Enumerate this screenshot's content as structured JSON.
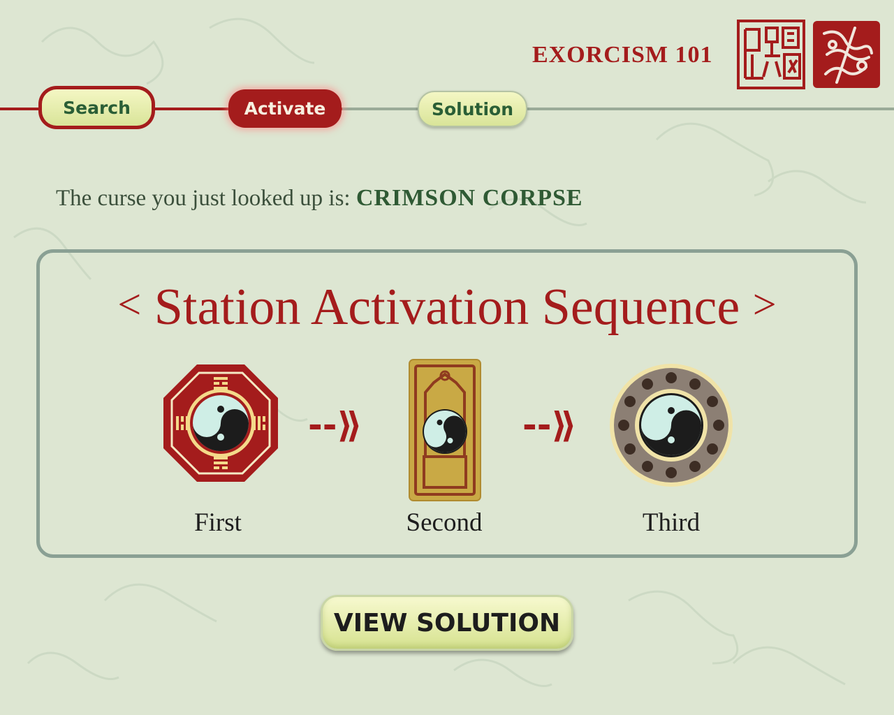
{
  "header": {
    "title": "EXORCISM 101"
  },
  "nav": {
    "search_label": "Search",
    "activate_label": "Activate",
    "solution_label": "Solution",
    "active_tab": "Activate"
  },
  "curse": {
    "prefix": "The curse you just looked up is:",
    "name": "CRIMSON CORPSE"
  },
  "sequence": {
    "title": "Station Activation Sequence",
    "bracket_left": "<",
    "bracket_right": ">",
    "arrow": "--⟫",
    "stations": [
      {
        "label": "First",
        "icon": "bagua-octagon-icon"
      },
      {
        "label": "Second",
        "icon": "talisman-tablet-icon"
      },
      {
        "label": "Third",
        "icon": "prayer-bead-disc-icon"
      }
    ]
  },
  "actions": {
    "view_solution_label": "VIEW SOLUTION"
  },
  "colors": {
    "accent_red": "#a41c1c",
    "text_green": "#2f5a34",
    "background": "#dde6d2",
    "button_yellow": "#eef3b8"
  }
}
